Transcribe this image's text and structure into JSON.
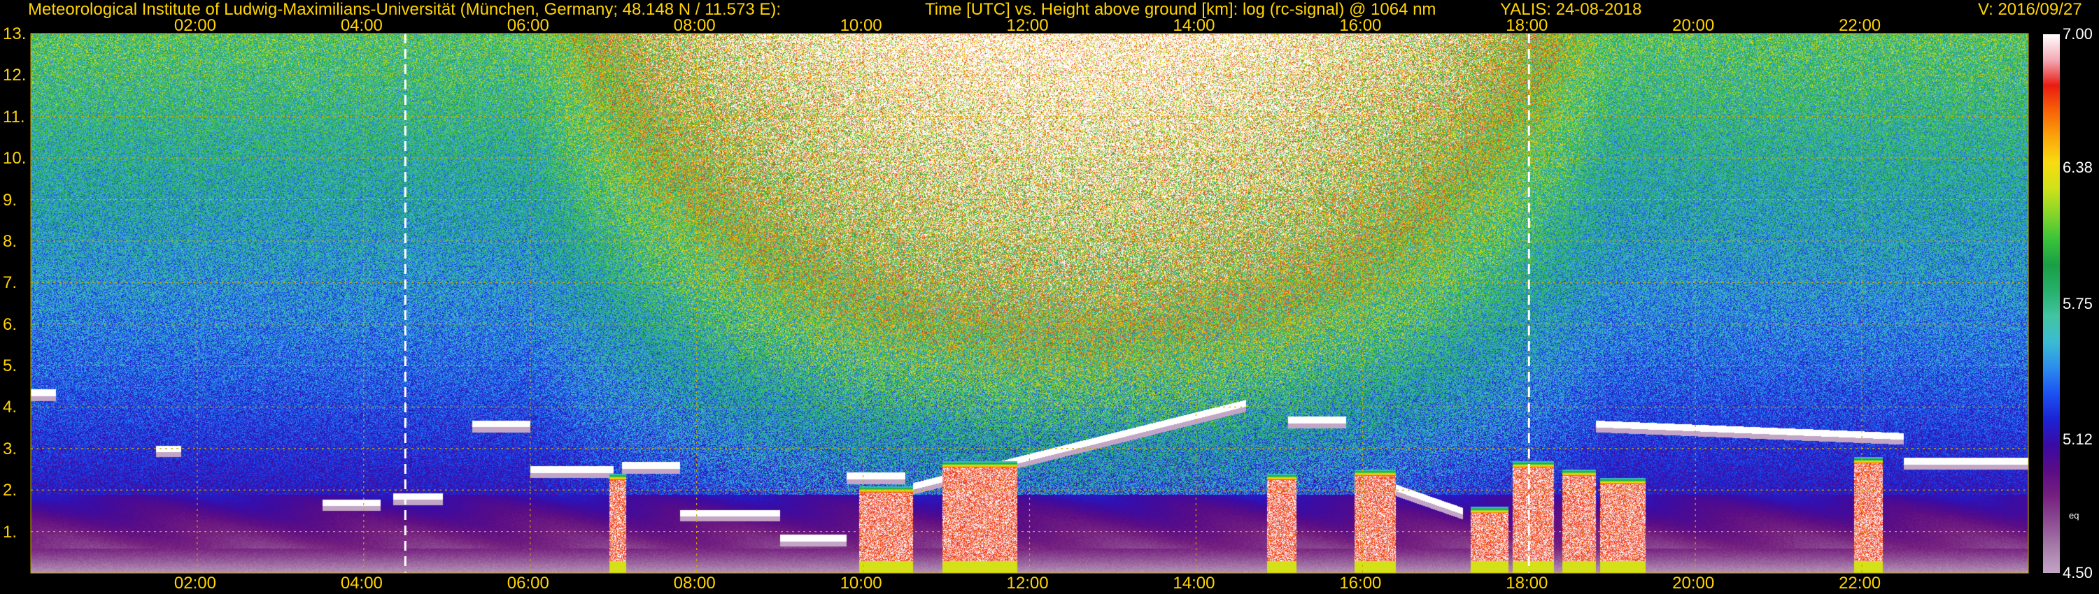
{
  "header": {
    "institute": "Meteorological Institute of Ludwig-Maximilians-Universität (München, Germany; 48.148 N / 11.573 E):",
    "plot_desc": "Time [UTC] vs. Height above ground [km]: log (rc-signal) @ 1064 nm",
    "station_date": "YALIS: 24-08-2018",
    "version": "V: 2016/09/27"
  },
  "colors": {
    "text": "#ffd400",
    "background": "#000000",
    "grid": "#c8a800",
    "marker": "#ffffff"
  },
  "chart_data": {
    "type": "heatmap",
    "x_range_hours": [
      0.0,
      24.0
    ],
    "x_tick_labels": [
      "02:00",
      "04:00",
      "06:00",
      "08:00",
      "10:00",
      "12:00",
      "14:00",
      "16:00",
      "18:00",
      "20:00",
      "22:00"
    ],
    "y_range_km": [
      0,
      13
    ],
    "y_tick_labels": [
      "1.",
      "2.",
      "3.",
      "4.",
      "5.",
      "6.",
      "7.",
      "8.",
      "9.",
      "10.",
      "11.",
      "12.",
      "13."
    ],
    "colorbar": {
      "range": [
        4.5,
        7.0
      ],
      "tick_labels": [
        "7.00",
        "6.38",
        "5.75",
        "5.12",
        "4.50"
      ],
      "note": "eq"
    },
    "colorbar_scale": [
      "#c3a6c6",
      "#a77ca9",
      "#8d4c93",
      "#75207f",
      "#5a0c85",
      "#3a0ba4",
      "#1b24d6",
      "#1c52f1",
      "#2c8ded",
      "#3bbcd3",
      "#43c4a2",
      "#26b06c",
      "#1a9e45",
      "#39c33a",
      "#86d628",
      "#cfe21a",
      "#f8dc11",
      "#fba40a",
      "#f76408",
      "#e81c12",
      "#f3a9b6",
      "#ffffff"
    ],
    "ceilometer_markers_hours": [
      4.5,
      18.0
    ],
    "cloud_layers": [
      {
        "t0": 0.0,
        "t1": 0.3,
        "h": 4.35
      },
      {
        "t0": 1.5,
        "t1": 1.8,
        "h": 3.0
      },
      {
        "t0": 3.5,
        "t1": 4.2,
        "h": 1.7
      },
      {
        "t0": 4.35,
        "t1": 4.95,
        "h": 1.85
      },
      {
        "t0": 5.3,
        "t1": 6.0,
        "h": 3.6
      },
      {
        "t0": 6.0,
        "t1": 7.0,
        "h": 2.5
      },
      {
        "t0": 7.1,
        "t1": 8.0,
        "h": 2.6
      },
      {
        "t0": 7.8,
        "t1": 9.0,
        "h": 1.45
      },
      {
        "t0": 9.0,
        "t1": 9.8,
        "h": 0.85
      },
      {
        "t0": 9.8,
        "t1": 10.5,
        "h": 2.35
      },
      {
        "t0": 10.6,
        "t1": 14.6,
        "h": 2.1,
        "h_end": 4.1
      },
      {
        "t0": 15.1,
        "t1": 15.8,
        "h": 3.7
      },
      {
        "t0": 16.2,
        "t1": 17.2,
        "h": 2.2,
        "h_end": 1.5
      },
      {
        "t0": 18.8,
        "t1": 22.5,
        "h": 3.6,
        "h_end": 3.3
      },
      {
        "t0": 22.5,
        "t1": 24.0,
        "h": 2.7
      }
    ],
    "convective_cells": [
      {
        "t0": 6.95,
        "t1": 7.15,
        "top": 2.4
      },
      {
        "t0": 9.95,
        "t1": 10.6,
        "top": 2.1
      },
      {
        "t0": 10.95,
        "t1": 11.85,
        "top": 2.7
      },
      {
        "t0": 14.85,
        "t1": 15.2,
        "top": 2.4
      },
      {
        "t0": 15.9,
        "t1": 16.4,
        "top": 2.5
      },
      {
        "t0": 17.3,
        "t1": 17.75,
        "top": 1.6
      },
      {
        "t0": 17.8,
        "t1": 18.3,
        "top": 2.7
      },
      {
        "t0": 18.4,
        "t1": 18.8,
        "top": 2.5
      },
      {
        "t0": 18.85,
        "t1": 19.4,
        "top": 2.3
      },
      {
        "t0": 21.9,
        "t1": 22.25,
        "top": 2.8
      }
    ]
  }
}
